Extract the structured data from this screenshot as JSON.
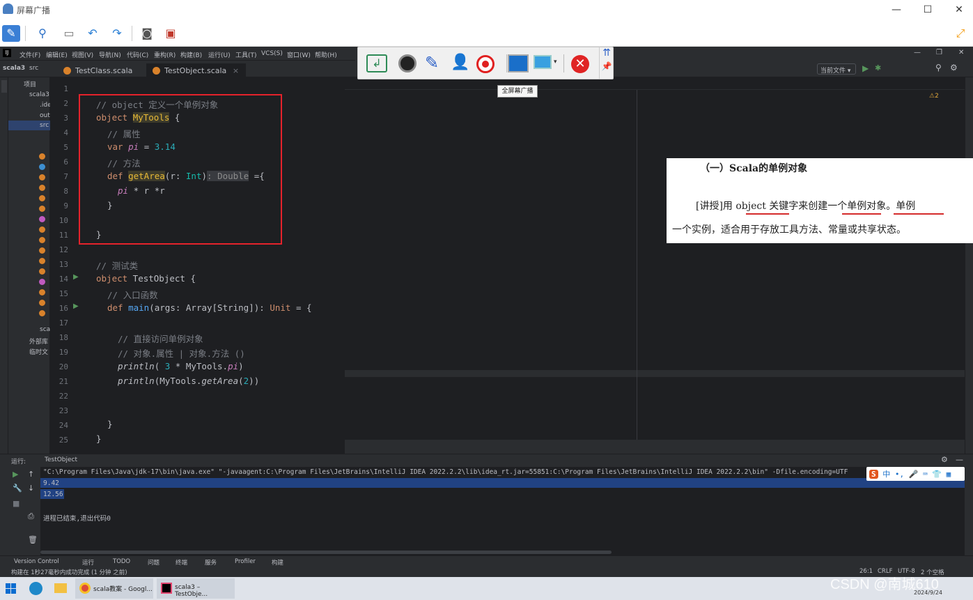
{
  "window": {
    "title": "屏幕广播",
    "minimize": "—",
    "maximize": "☐",
    "close": "✕"
  },
  "ide_menu": [
    "文件(F)",
    "编辑(E)",
    "视图(V)",
    "导航(N)",
    "代码(C)",
    "重构(R)",
    "构建(B)",
    "运行(U)",
    "工具(T)",
    "VCS(S)",
    "窗口(W)",
    "帮助(H)"
  ],
  "breadcrumb": {
    "project": "scala3",
    "folder": "src"
  },
  "tabs": [
    {
      "label": "TestClass.scala",
      "active": false
    },
    {
      "label": "TestObject.scala",
      "active": true
    }
  ],
  "project_panel": {
    "title": "项目",
    "items": [
      "scala3",
      ".ide",
      "out",
      "src",
      "scal",
      "外部库",
      "临时文"
    ]
  },
  "run_config": "当前文件",
  "line_numbers": [
    "1",
    "2",
    "3",
    "4",
    "5",
    "6",
    "7",
    "8",
    "9",
    "10",
    "11",
    "12",
    "13",
    "14",
    "15",
    "16",
    "17",
    "18",
    "19",
    "20",
    "21",
    "22",
    "23",
    "24",
    "25"
  ],
  "code": {
    "l2": "// object 定义一个单例对象",
    "l3_kw": "object",
    "l3_name": "MyTools",
    "l3_rest": " {",
    "l4": "// 属性",
    "l5_kw": "var",
    "l5_name": "pi",
    "l5_eq": " = ",
    "l5_num": "3.14",
    "l6": "// 方法",
    "l7_kw": "def",
    "l7_name": "getArea",
    "l7_args": "(r: ",
    "l7_type": "Int",
    "l7_close": ")",
    "l7_hint": ": Double",
    "l7_end": " ={",
    "l8_pi": "pi",
    "l8_rest": " * r *r",
    "l9": "}",
    "l11": "}",
    "l13": "// 测试类",
    "l14_kw": "object",
    "l14_rest": " TestObject {",
    "l15": "// 入口函数",
    "l16_kw": "def",
    "l16_name": "main",
    "l16_rest": "(args: Array[String]): ",
    "l16_type": "Unit",
    "l16_end": " = {",
    "l18": "// 直接访问单例对象",
    "l19": "// 对象.属性 | 对象.方法 ()",
    "l20_fn": "println",
    "l20_a": "( ",
    "l20_num": "3",
    "l20_b": " * MyTools.",
    "l20_pi": "pi",
    "l20_c": ")",
    "l21_fn": "println",
    "l21_a": "(MyTools.",
    "l21_m": "getArea",
    "l21_b": "(",
    "l21_num": "2",
    "l21_c": "))",
    "l24": "}",
    "l25": "}"
  },
  "popup_tooltip": "全屏幕广播",
  "doc_card": {
    "heading": "（一）Scala的单例对象",
    "para1": "[讲授]用 object 关键字来创建一个单例对象。单例",
    "para2": "一个实例，适合用于存放工具方法、常量或共享状态。"
  },
  "warnings": "⚠2",
  "run_panel": {
    "label": "运行:",
    "config": "TestObject",
    "command": "\"C:\\Program Files\\Java\\jdk-17\\bin\\java.exe\" \"-javaagent:C:\\Program Files\\JetBrains\\IntelliJ IDEA 2022.2.2\\lib\\idea_rt.jar=55851:C:\\Program Files\\JetBrains\\IntelliJ IDEA 2022.2.2\\bin\" -Dfile.encoding=UTF",
    "output": [
      "9.42",
      "12.56"
    ],
    "exit": "进程已结束,退出代码0"
  },
  "bottom_tabs": [
    "Version Control",
    "运行",
    "TODO",
    "问题",
    "终端",
    "服务",
    "Profiler",
    "构建"
  ],
  "status": {
    "message": "构建在 1秒27毫秒内成功完成 (1 分钟 之前)",
    "position": "26:1",
    "line_sep": "CRLF",
    "encoding": "UTF-8",
    "indent": "2 个空格"
  },
  "ime": {
    "lang": "中"
  },
  "taskbar": {
    "items": [
      {
        "label": "scala教案 - Googl..."
      },
      {
        "label": "scala3 – TestObje..."
      }
    ],
    "date": "2024/9/24",
    "watermark": "CSDN @南城610"
  },
  "colors": {
    "accent": "#3574f0",
    "redbox": "#e5222b",
    "selection": "#214283"
  }
}
